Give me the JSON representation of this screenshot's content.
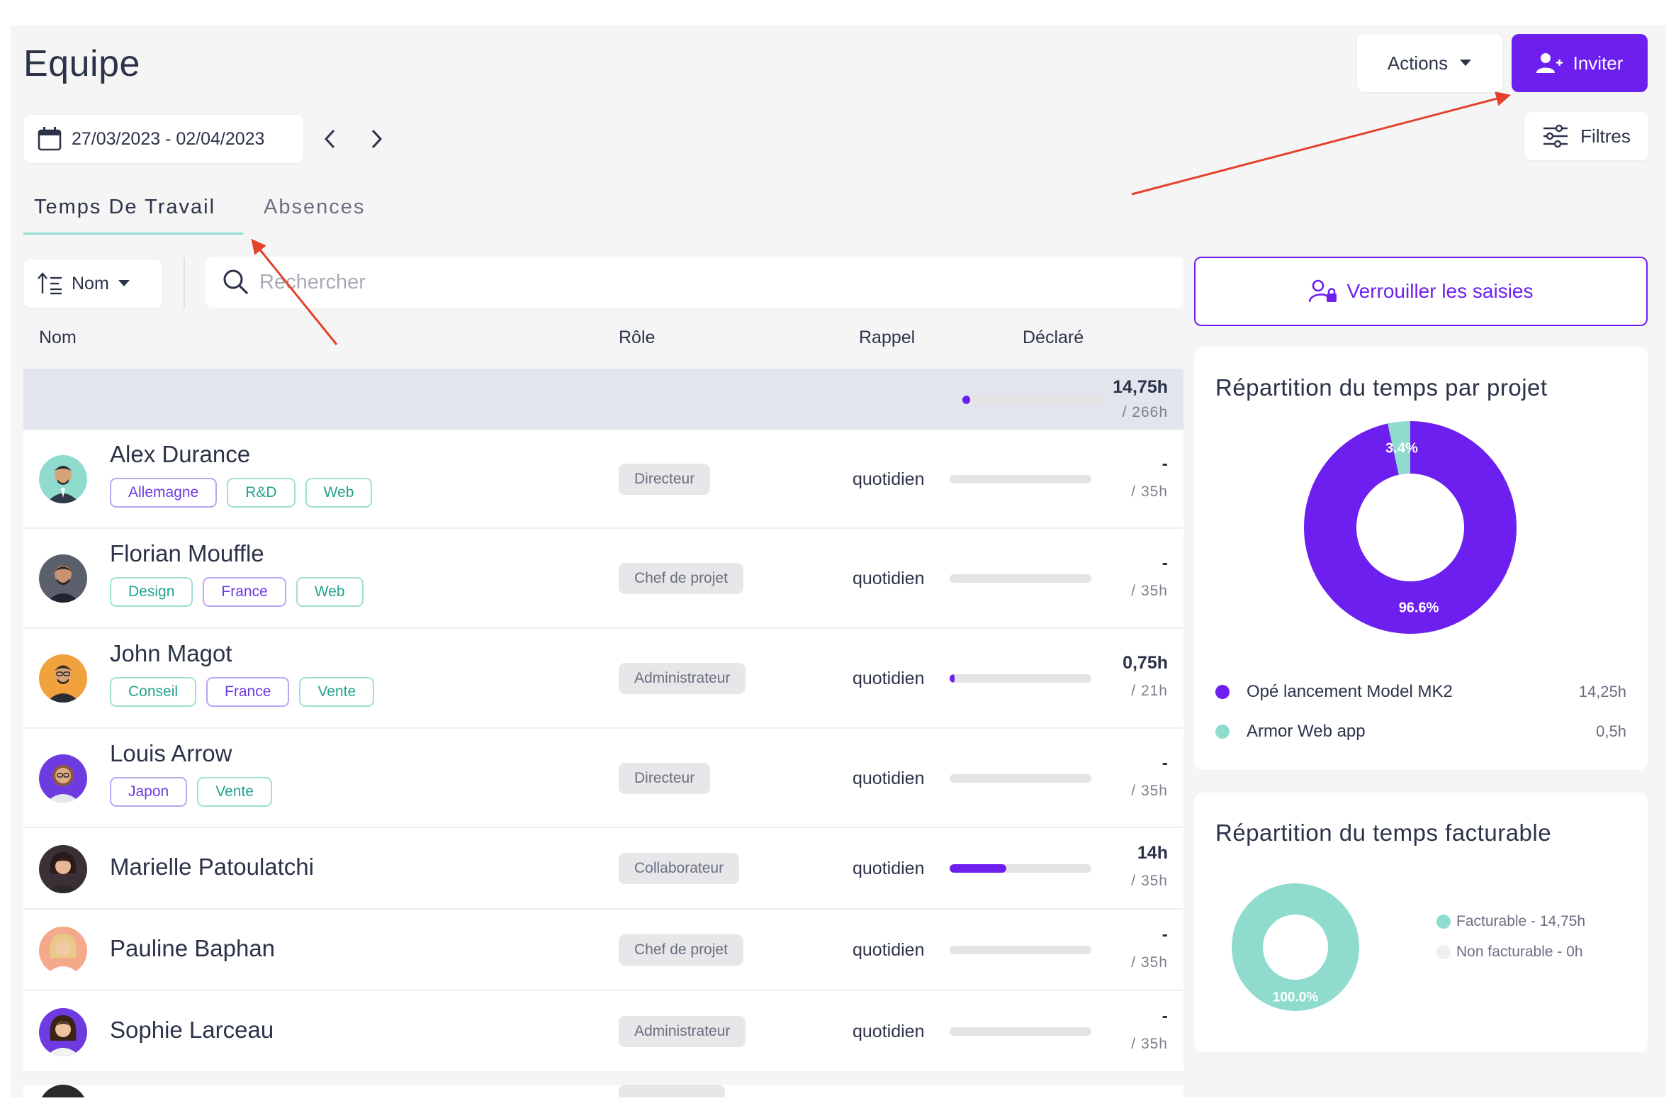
{
  "page": {
    "title": "Equipe"
  },
  "header": {
    "actions_label": "Actions",
    "invite_label": "Inviter",
    "filters_label": "Filtres"
  },
  "date_range": "27/03/2023 - 02/04/2023",
  "tabs": [
    {
      "label": "Temps De Travail",
      "active": true
    },
    {
      "label": "Absences",
      "active": false
    }
  ],
  "toolbar": {
    "sort_label": "Nom",
    "search_placeholder": "Rechercher"
  },
  "columns": {
    "name": "Nom",
    "role": "Rôle",
    "reminder": "Rappel",
    "declared": "Déclaré"
  },
  "summary": {
    "declared": "14,75h",
    "total": "/ 266h",
    "progress": 0.055
  },
  "members": [
    {
      "name": "Alex Durance",
      "tags": [
        {
          "label": "Allemagne",
          "color": "purple"
        },
        {
          "label": "R&D",
          "color": "teal"
        },
        {
          "label": "Web",
          "color": "teal"
        }
      ],
      "role": "Directeur",
      "reminder": "quotidien",
      "declared": "-",
      "total": "/ 35h",
      "progress": 0
    },
    {
      "name": "Florian Mouffle",
      "tags": [
        {
          "label": "Design",
          "color": "teal"
        },
        {
          "label": "France",
          "color": "purple"
        },
        {
          "label": "Web",
          "color": "teal"
        }
      ],
      "role": "Chef de projet",
      "reminder": "quotidien",
      "declared": "-",
      "total": "/ 35h",
      "progress": 0
    },
    {
      "name": "John Magot",
      "tags": [
        {
          "label": "Conseil",
          "color": "teal"
        },
        {
          "label": "France",
          "color": "purple"
        },
        {
          "label": "Vente",
          "color": "teal"
        }
      ],
      "role": "Administrateur",
      "reminder": "quotidien",
      "declared": "0,75h",
      "total": "/ 21h",
      "progress": 0.036
    },
    {
      "name": "Louis Arrow",
      "tags": [
        {
          "label": "Japon",
          "color": "purple"
        },
        {
          "label": "Vente",
          "color": "teal"
        }
      ],
      "role": "Directeur",
      "reminder": "quotidien",
      "declared": "-",
      "total": "/ 35h",
      "progress": 0
    },
    {
      "name": "Marielle Patoulatchi",
      "tags": [],
      "role": "Collaborateur",
      "reminder": "quotidien",
      "declared": "14h",
      "total": "/ 35h",
      "progress": 0.4
    },
    {
      "name": "Pauline Baphan",
      "tags": [],
      "role": "Chef de projet",
      "reminder": "quotidien",
      "declared": "-",
      "total": "/ 35h",
      "progress": 0
    },
    {
      "name": "Sophie Larceau",
      "tags": [],
      "role": "Administrateur",
      "reminder": "quotidien",
      "declared": "-",
      "total": "/ 35h",
      "progress": 0
    }
  ],
  "lock_button": "Verrouiller les saisies",
  "project_card": {
    "title": "Répartition du temps par projet",
    "slices": [
      {
        "name": "Opé lancement Model MK2",
        "value": 96.6,
        "label": "96.6%",
        "hours": "14,25h",
        "color": "#6d1ff0"
      },
      {
        "name": "Armor Web app",
        "value": 3.4,
        "label": "3.4%",
        "hours": "0,5h",
        "color": "#8fdccf"
      }
    ]
  },
  "billable_card": {
    "title": "Répartition du temps facturable",
    "slices": [
      {
        "name": "Facturable - 14,75h",
        "value": 100,
        "label": "100.0%",
        "color": "#8fdccf"
      },
      {
        "name": "Non facturable - 0h",
        "value": 0,
        "label": "",
        "color": "#eeeeee"
      }
    ]
  },
  "colors": {
    "accent": "#6d1ff0",
    "teal": "#8fdccf",
    "annotation": "#e4412b"
  }
}
